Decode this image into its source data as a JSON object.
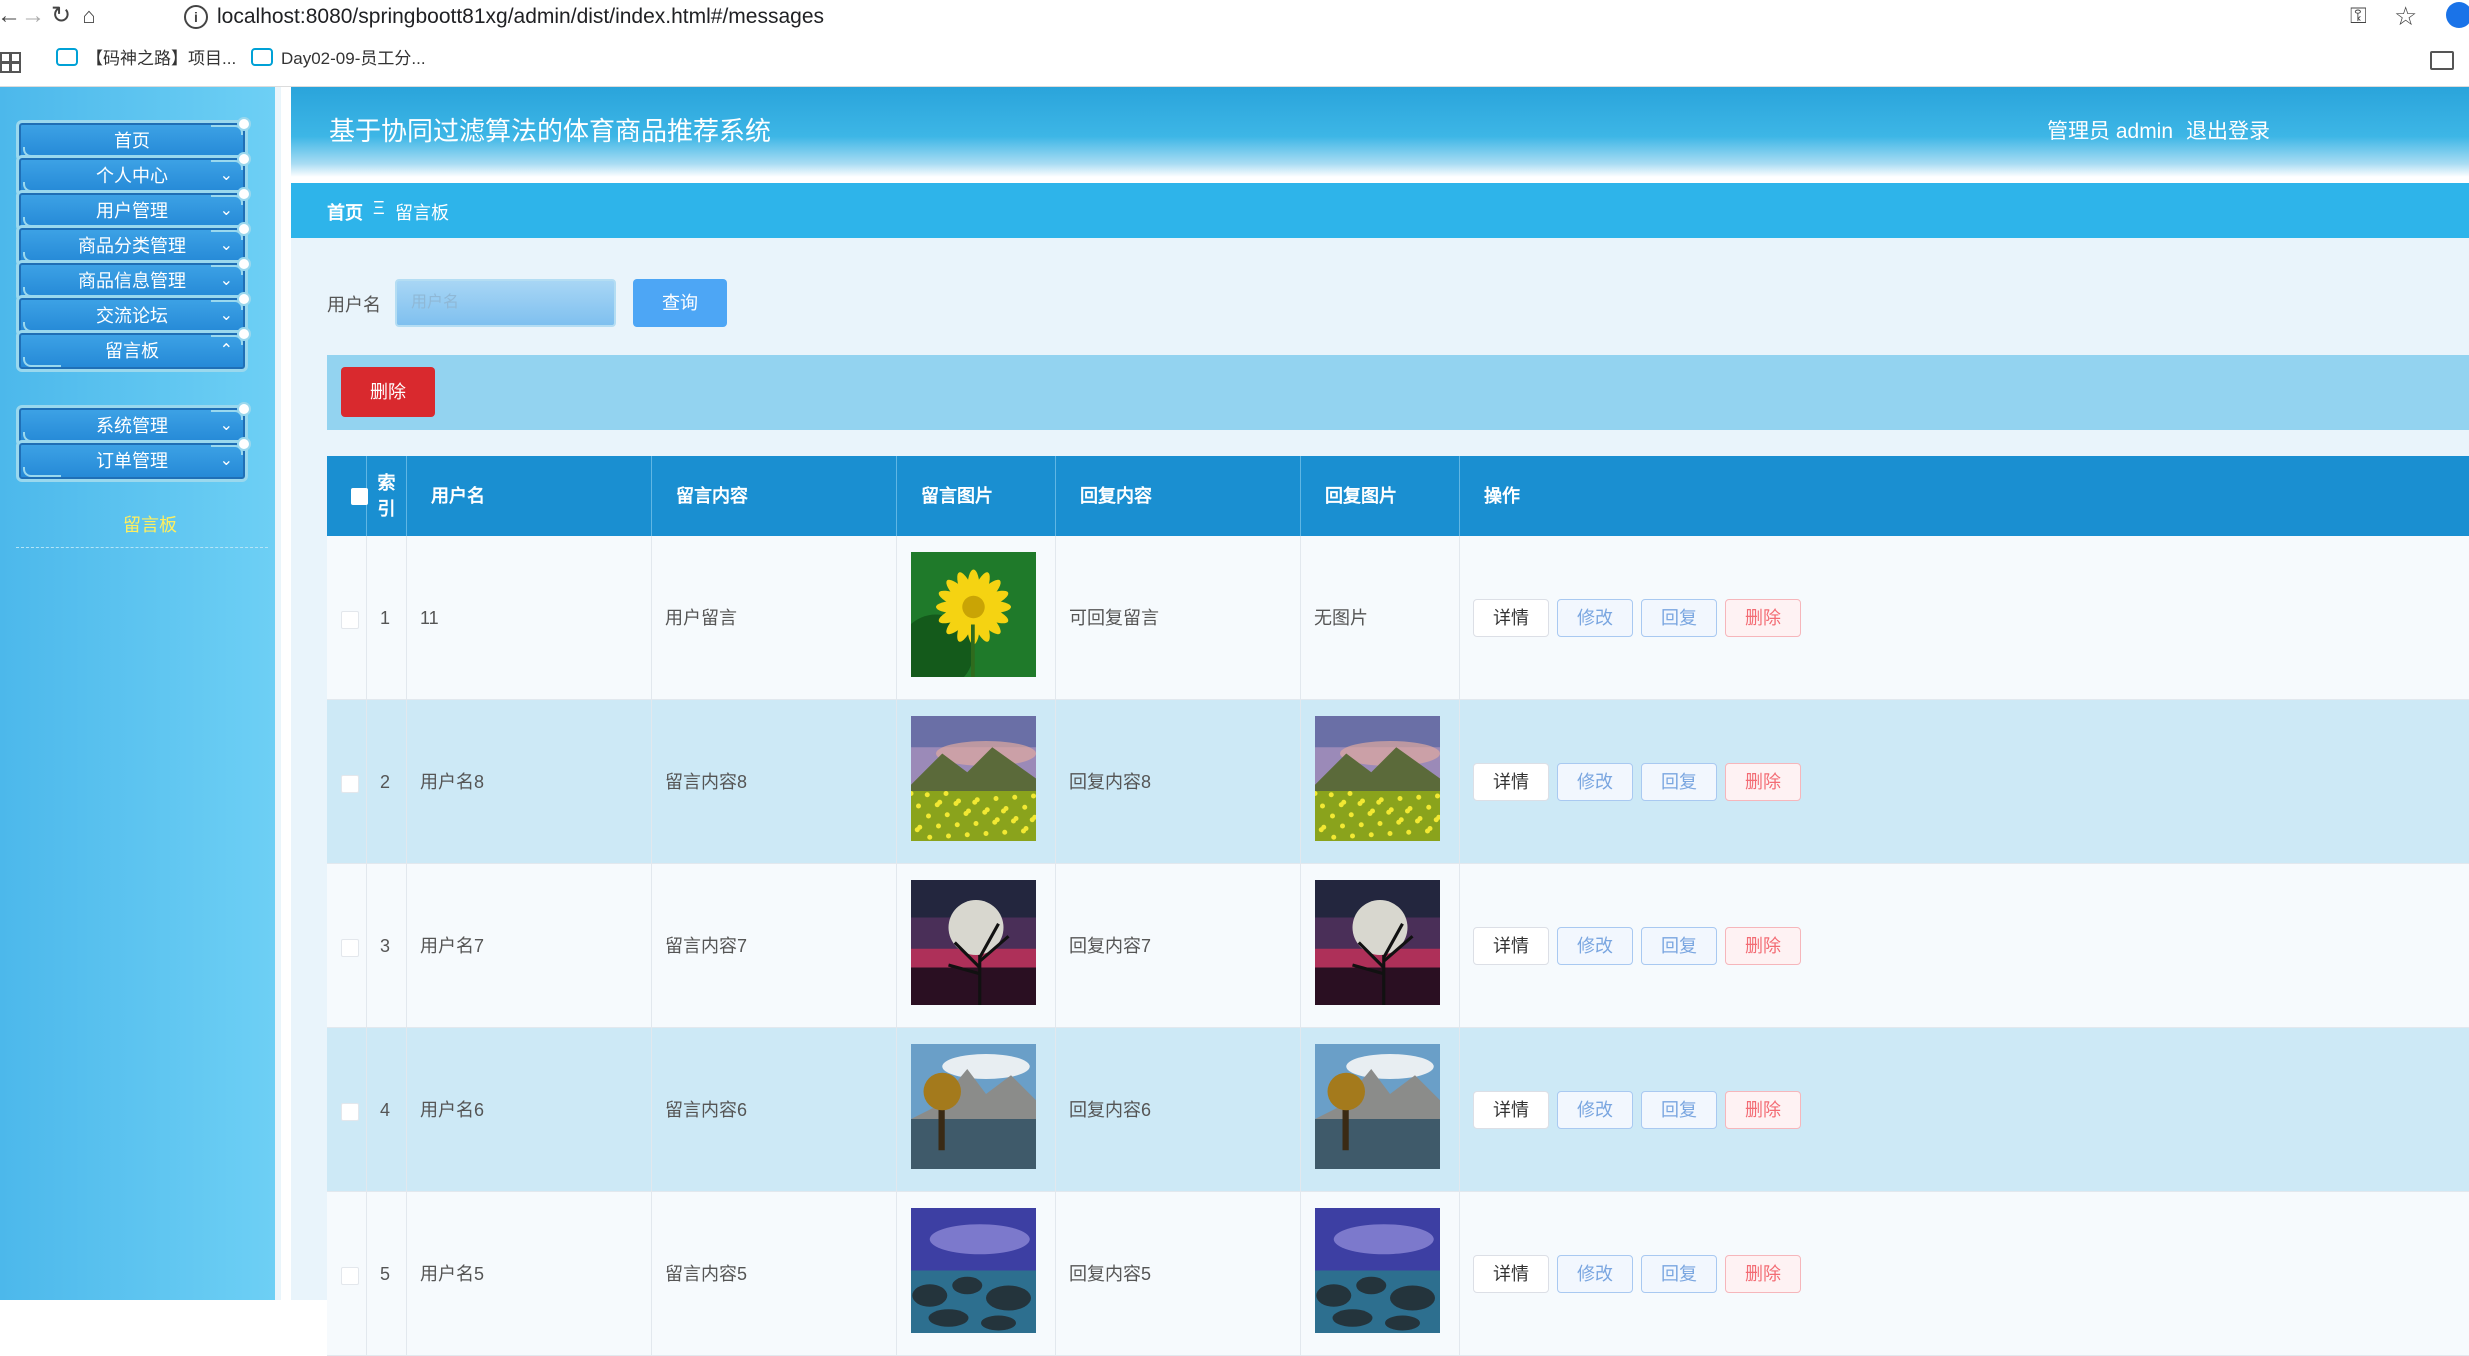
{
  "browser": {
    "url": "localhost:8080/springboott81xg/admin/dist/index.html#/messages",
    "bookmarks": [
      "【码神之路】项目...",
      "Day02-09-员工分..."
    ]
  },
  "sidebar": {
    "items": [
      {
        "label": "首页",
        "chevron": false
      },
      {
        "label": "个人中心",
        "chevron": true
      },
      {
        "label": "用户管理",
        "chevron": true
      },
      {
        "label": "商品分类管理",
        "chevron": true
      },
      {
        "label": "商品信息管理",
        "chevron": true
      },
      {
        "label": "交流论坛",
        "chevron": true
      },
      {
        "label": "留言板",
        "chevron": true,
        "expanded": true
      },
      {
        "label": "系统管理",
        "chevron": true
      },
      {
        "label": "订单管理",
        "chevron": true
      }
    ],
    "submenu_active": "留言板"
  },
  "header": {
    "title": "基于协同过滤算法的体育商品推荐系统",
    "user": "管理员 admin",
    "logout": "退出登录"
  },
  "breadcrumb": {
    "home": "首页",
    "separator": "Ξ",
    "current": "留言板"
  },
  "search": {
    "label": "用户名",
    "placeholder": "用户名",
    "button": "查询"
  },
  "actions": {
    "delete": "删除"
  },
  "table": {
    "columns": [
      "索引",
      "用户名",
      "留言内容",
      "留言图片",
      "回复内容",
      "回复图片",
      "操作"
    ],
    "index_header_line1": "索",
    "index_header_line2": "引",
    "row_buttons": {
      "detail": "详情",
      "edit": "修改",
      "reply": "回复",
      "delete": "删除"
    },
    "rows": [
      {
        "index": "1",
        "username": "11",
        "content": "用户留言",
        "image": "flower",
        "reply": "可回复留言",
        "reply_image": "无图片"
      },
      {
        "index": "2",
        "username": "用户名8",
        "content": "留言内容8",
        "image": "meadow",
        "reply": "回复内容8",
        "reply_image": "meadow"
      },
      {
        "index": "3",
        "username": "用户名7",
        "content": "留言内容7",
        "image": "moon",
        "reply": "回复内容7",
        "reply_image": "moon"
      },
      {
        "index": "4",
        "username": "用户名6",
        "content": "留言内容6",
        "image": "lake",
        "reply": "回复内容6",
        "reply_image": "lake"
      },
      {
        "index": "5",
        "username": "用户名5",
        "content": "留言内容5",
        "image": "rocks",
        "reply": "回复内容5",
        "reply_image": "rocks"
      }
    ]
  },
  "colors": {
    "header": "#2aa4db",
    "breadcrumb": "#2eb4ea",
    "table_header": "#1a8fd1",
    "danger": "#d9292e",
    "primary": "#4da6f5"
  }
}
